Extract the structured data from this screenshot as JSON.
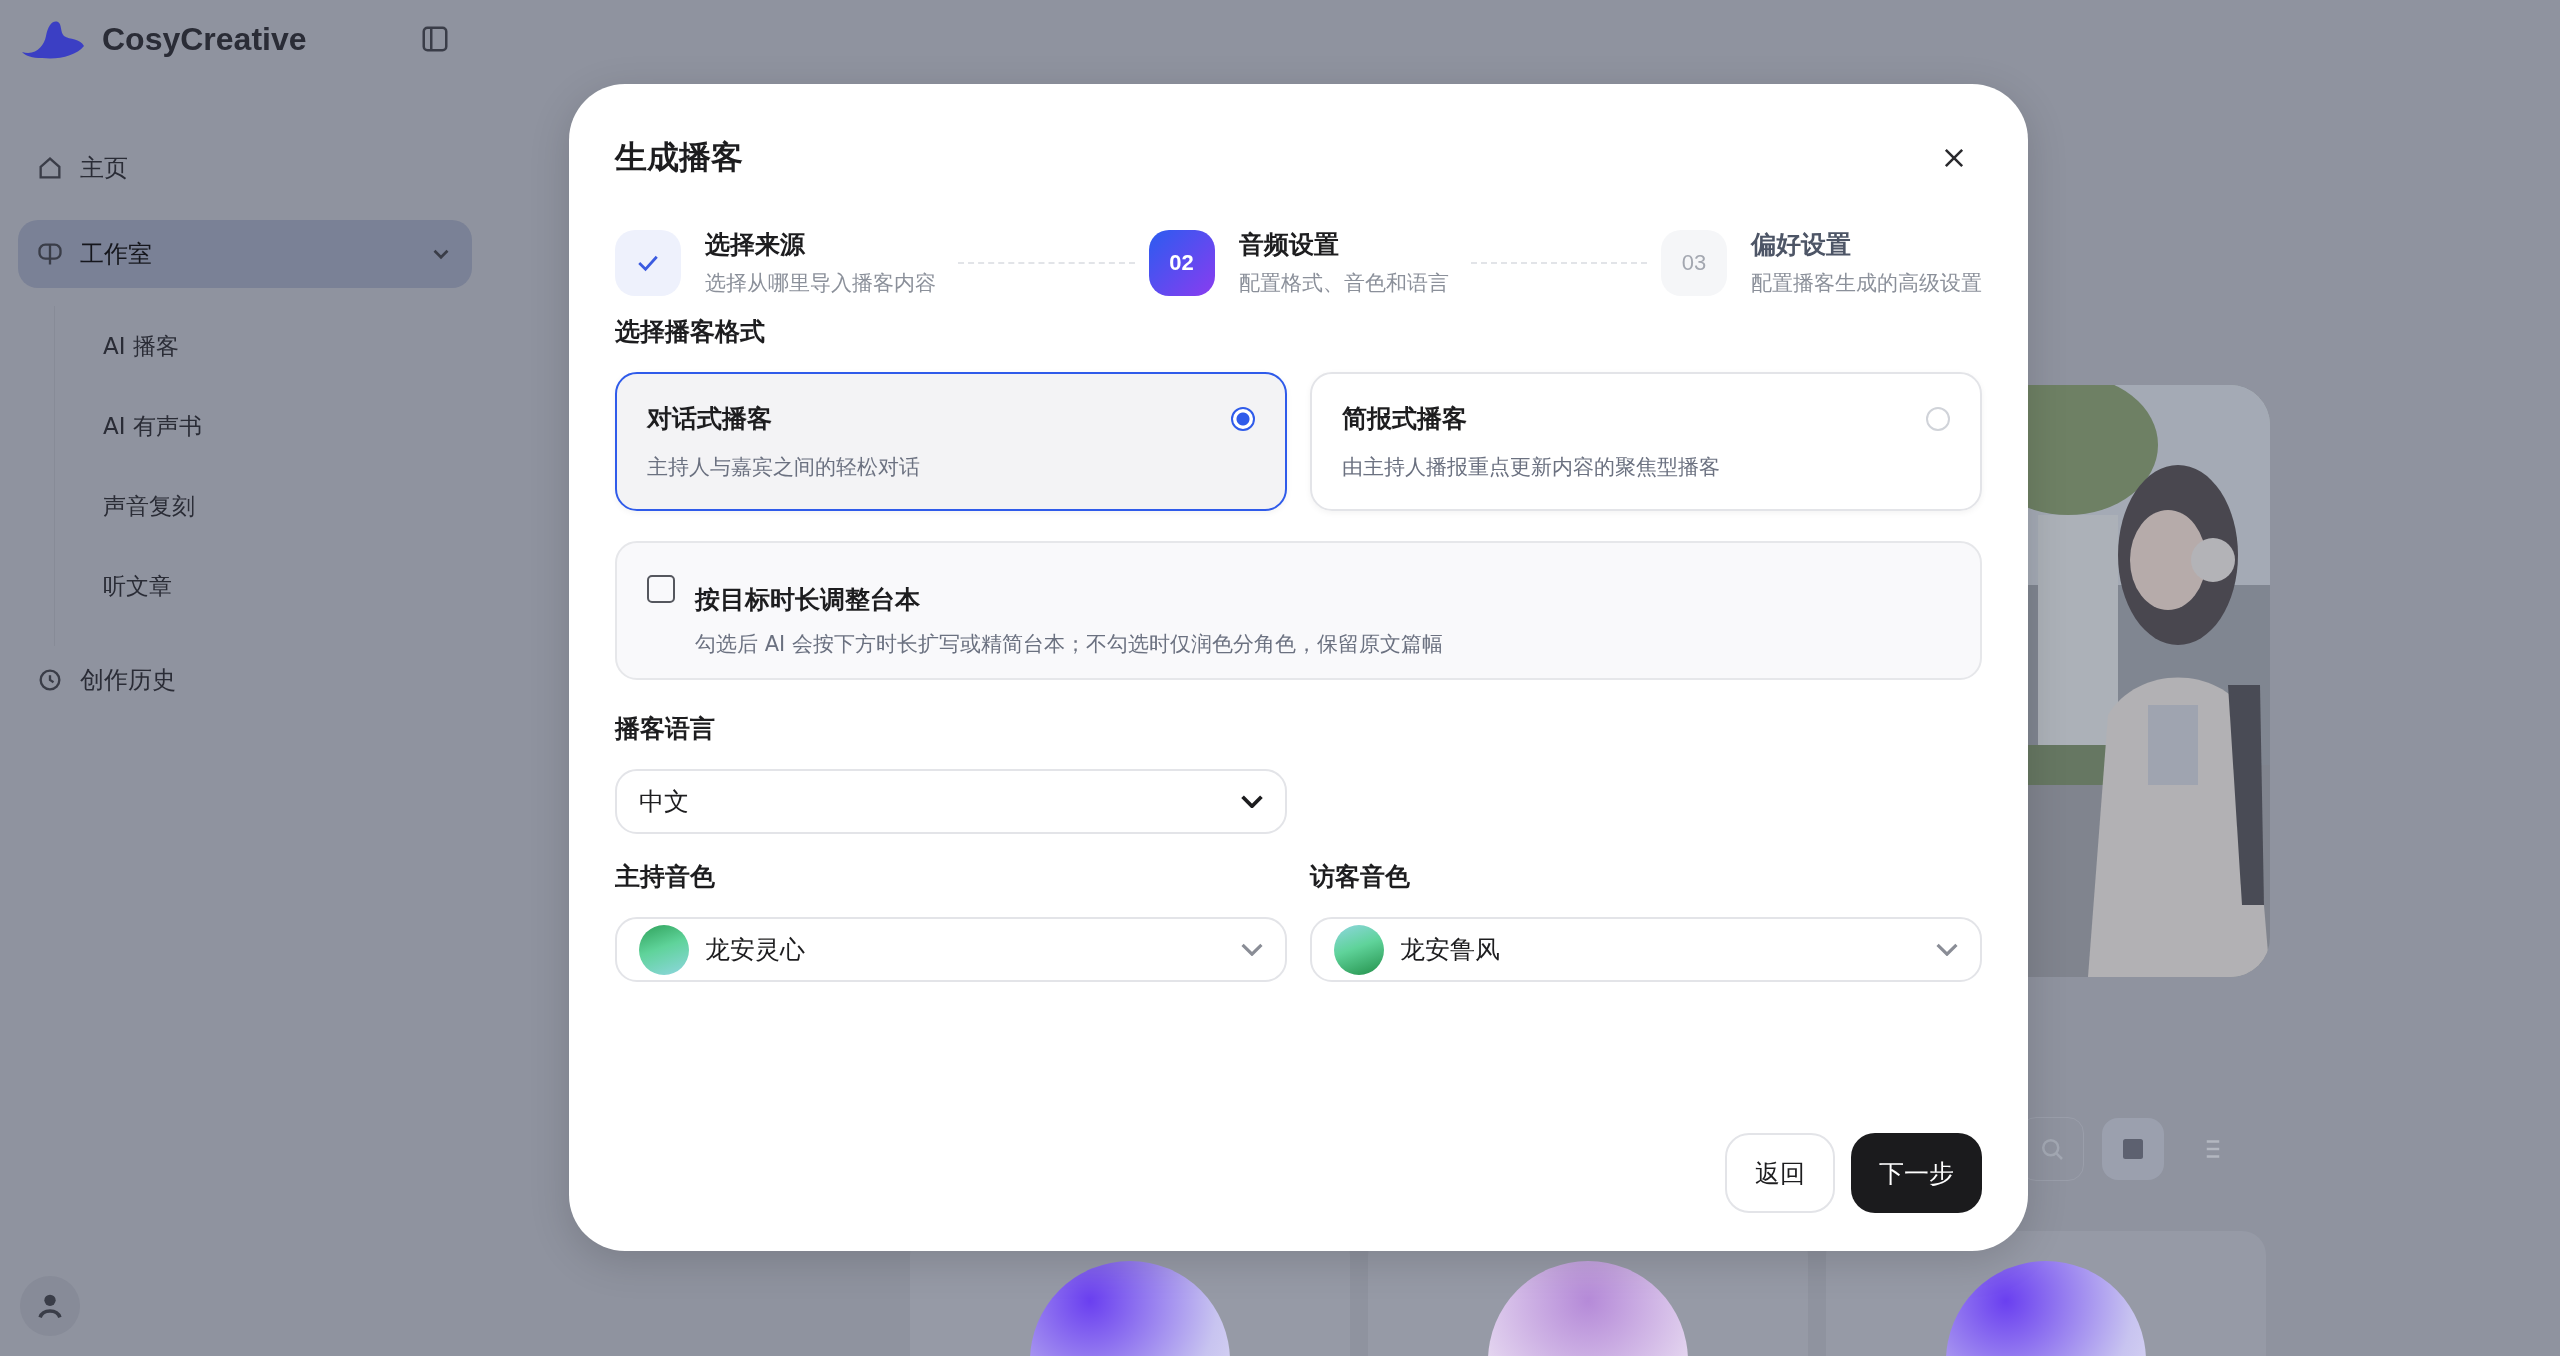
{
  "sidebar": {
    "brand": "CosyCreative",
    "items": [
      {
        "label": "主页",
        "kind": "home",
        "selected": false
      },
      {
        "label": "工作室",
        "kind": "studio",
        "selected": true,
        "expanded": true,
        "children": [
          {
            "label": "AI 播客",
            "selected": false
          },
          {
            "label": "AI 有声书",
            "selected": false
          },
          {
            "label": "声音复刻",
            "selected": false
          },
          {
            "label": "听文章",
            "selected": false
          }
        ]
      },
      {
        "label": "创作历史",
        "kind": "history",
        "selected": false
      }
    ]
  },
  "main": {
    "view_toggle": [
      {
        "kind": "grid",
        "selected": true
      },
      {
        "kind": "list",
        "selected": false
      }
    ]
  },
  "modal": {
    "title": "生成播客",
    "steps": [
      {
        "kind": "done",
        "title": "选择来源",
        "subtitle": "选择从哪里导入播客内容"
      },
      {
        "kind": "current",
        "number": "02",
        "title": "音频设置",
        "subtitle": "配置格式、音色和语言"
      },
      {
        "kind": "pending",
        "number": "03",
        "title": "偏好设置",
        "subtitle": "配置播客生成的高级设置"
      }
    ],
    "format": {
      "label": "选择播客格式",
      "options": [
        {
          "title": "对话式播客",
          "description": "主持人与嘉宾之间的轻松对话",
          "selected": true
        },
        {
          "title": "简报式播客",
          "description": "由主持人播报重点更新内容的聚焦型播客",
          "selected": false
        }
      ]
    },
    "adjust": {
      "title": "按目标时长调整台本",
      "description": "勾选后 AI 会按下方时长扩写或精简台本；不勾选时仅润色分角色，保留原文篇幅",
      "checked": false
    },
    "language": {
      "label": "播客语言",
      "value": "中文"
    },
    "voices": [
      {
        "label": "主持音色",
        "value": "龙安灵心"
      },
      {
        "label": "访客音色",
        "value": "龙安鲁风"
      }
    ],
    "buttons": {
      "back": "返回",
      "next": "下一步"
    }
  }
}
